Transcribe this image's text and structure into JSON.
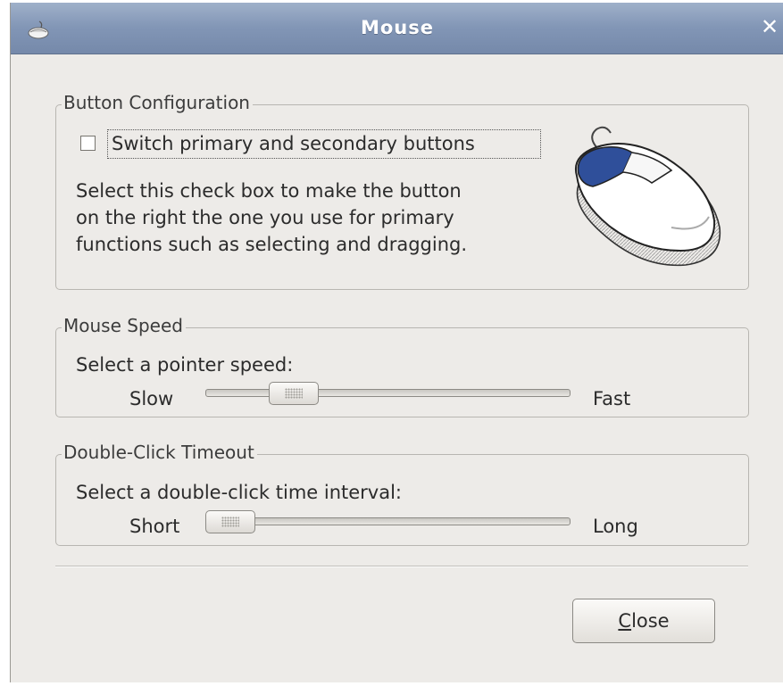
{
  "window": {
    "title": "Mouse",
    "close_glyph": "✕",
    "app_icon": "mouse-app-icon"
  },
  "button_configuration": {
    "legend": "Button Configuration",
    "checkbox_label": "Switch primary and secondary buttons",
    "checked": false,
    "description_lines": [
      "Select this check box to make the button",
      "on the right the one you use for primary",
      "functions such as selecting and dragging."
    ],
    "illustration": "mouse-illustration-icon"
  },
  "mouse_speed": {
    "legend": "Mouse Speed",
    "prompt": "Select a pointer speed:",
    "min_label": "Slow",
    "max_label": "Fast",
    "value_fraction": 0.2
  },
  "double_click": {
    "legend": "Double-Click Timeout",
    "prompt": "Select a double-click time interval:",
    "min_label": "Short",
    "max_label": "Long",
    "value_fraction": 0.0
  },
  "actions": {
    "close_label_mnemonic": "C",
    "close_label_rest": "lose"
  },
  "colors": {
    "titlebar": "#8296b6",
    "window_bg": "#edebe8",
    "mouse_button_accent": "#2f4f9a"
  }
}
